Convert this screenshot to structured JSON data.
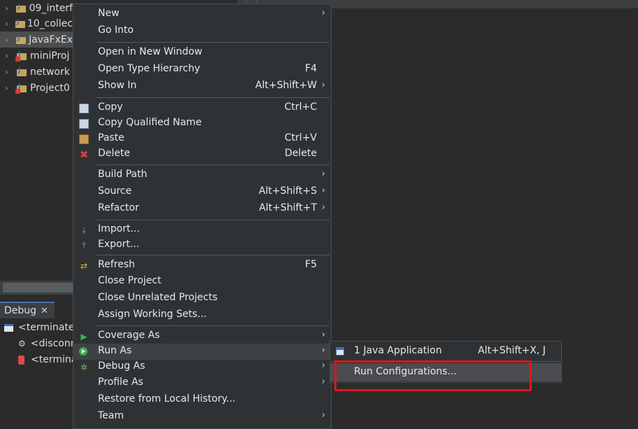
{
  "tree": {
    "items": [
      {
        "label": "09_interf",
        "error": false,
        "selected": false
      },
      {
        "label": "10_collec",
        "error": false,
        "selected": false
      },
      {
        "label": "JavaFxEx",
        "error": false,
        "selected": true
      },
      {
        "label": "miniProj",
        "error": true,
        "selected": false
      },
      {
        "label": "network",
        "error": false,
        "selected": false
      },
      {
        "label": "Project0",
        "error": true,
        "selected": false
      }
    ]
  },
  "debug": {
    "tab_label": "Debug",
    "close_glyph": "✕",
    "rows": [
      {
        "label": "<terminate",
        "icon": "launch-icon"
      },
      {
        "label": "<disconn",
        "icon": "gears-icon"
      },
      {
        "label": "<termina",
        "icon": "process-icon"
      }
    ]
  },
  "menu": {
    "items": [
      {
        "label": "New",
        "acc": "",
        "sub": "›"
      },
      {
        "label": "Go Into",
        "acc": "",
        "sub": ""
      },
      {
        "label": "Open in New Window",
        "acc": "",
        "sub": ""
      },
      {
        "label": "Open Type Hierarchy",
        "acc": "F4",
        "sub": ""
      },
      {
        "label": "Show In",
        "acc": "Alt+Shift+W",
        "sub": "›"
      },
      {
        "label": "Copy",
        "acc": "Ctrl+C",
        "sub": ""
      },
      {
        "label": "Copy Qualified Name",
        "acc": "",
        "sub": ""
      },
      {
        "label": "Paste",
        "acc": "Ctrl+V",
        "sub": ""
      },
      {
        "label": "Delete",
        "acc": "Delete",
        "sub": ""
      },
      {
        "label": "Build Path",
        "acc": "",
        "sub": "›"
      },
      {
        "label": "Source",
        "acc": "Alt+Shift+S",
        "sub": "›"
      },
      {
        "label": "Refactor",
        "acc": "Alt+Shift+T",
        "sub": "›"
      },
      {
        "label": "Import...",
        "acc": "",
        "sub": ""
      },
      {
        "label": "Export...",
        "acc": "",
        "sub": ""
      },
      {
        "label": "Refresh",
        "acc": "F5",
        "sub": ""
      },
      {
        "label": "Close Project",
        "acc": "",
        "sub": ""
      },
      {
        "label": "Close Unrelated Projects",
        "acc": "",
        "sub": ""
      },
      {
        "label": "Assign Working Sets...",
        "acc": "",
        "sub": ""
      },
      {
        "label": "Coverage As",
        "acc": "",
        "sub": "›"
      },
      {
        "label": "Run As",
        "acc": "",
        "sub": "›"
      },
      {
        "label": "Debug As",
        "acc": "",
        "sub": "›"
      },
      {
        "label": "Profile As",
        "acc": "",
        "sub": "›"
      },
      {
        "label": "Restore from Local History...",
        "acc": "",
        "sub": ""
      },
      {
        "label": "Team",
        "acc": "",
        "sub": "›"
      }
    ],
    "icons": {
      "copy": "copy-icon",
      "copy_qualified": "copy-qualified-name-icon",
      "paste": "paste-icon",
      "delete": "delete-icon",
      "import": "import-icon",
      "export": "export-icon",
      "refresh": "refresh-icon",
      "coverage": "coverage-icon",
      "run": "run-icon",
      "debug": "debug-icon"
    }
  },
  "submenu": {
    "items": [
      {
        "label": "1 Java Application",
        "acc": "Alt+Shift+X, J",
        "icon": "java-application-icon"
      },
      {
        "label": "Run Configurations...",
        "acc": "",
        "icon": ""
      }
    ]
  },
  "colors": {
    "background": "#2b2b2b",
    "menu_background": "#2f3235",
    "highlight_box": "#e0151b",
    "run_icon": "#3fb04d"
  }
}
